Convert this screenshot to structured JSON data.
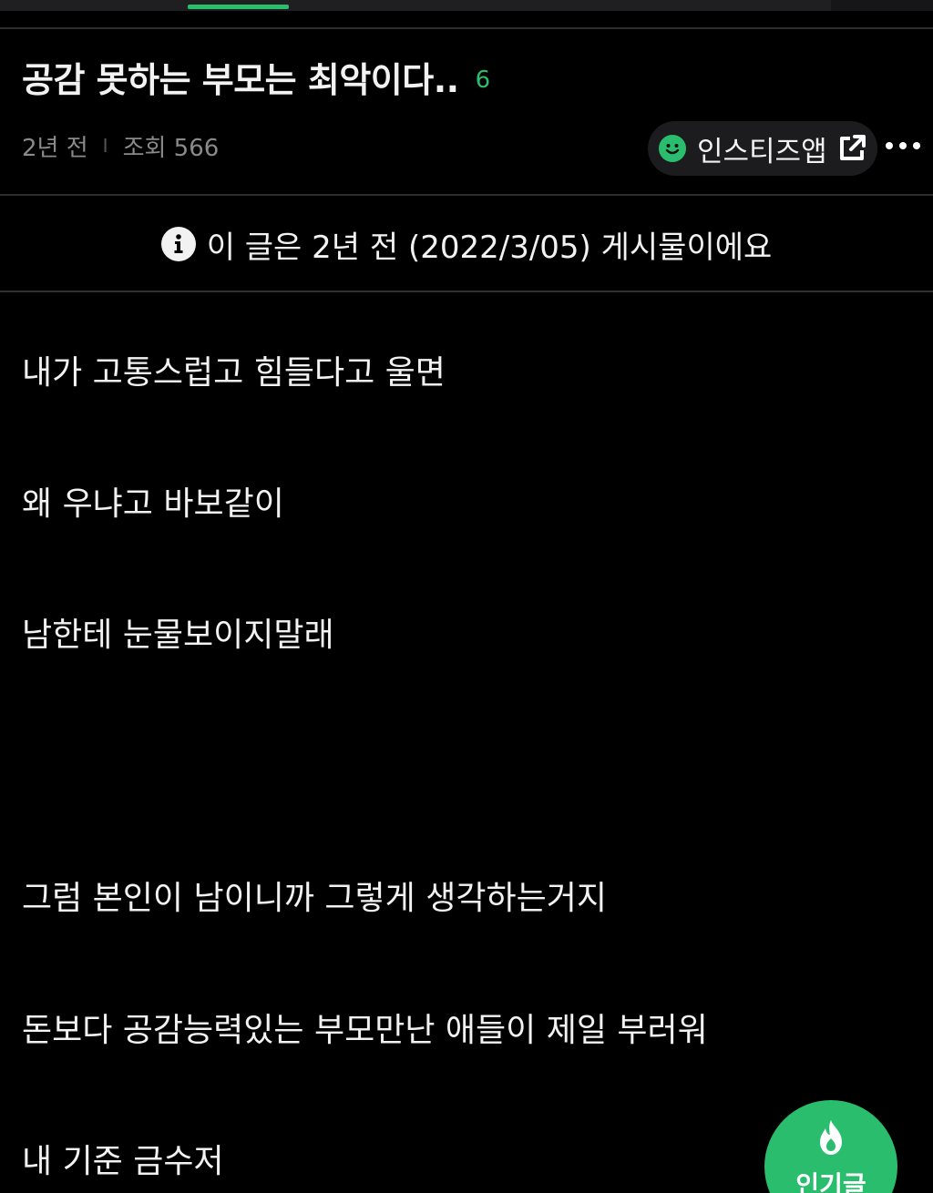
{
  "post": {
    "title": "공감 못하는 부모는 최악이다..",
    "comment_count": "6",
    "posted_ago": "2년 전",
    "views_label": "조회 566",
    "notice": "이 글은 2년 전 (2022/3/05) 게시물이에요",
    "body_lines": [
      "내가 고통스럽고 힘들다고 울면",
      "왜 우냐고 바보같이",
      "남한테 눈물보이지말래",
      "그럼 본인이 남이니까 그렇게 생각하는거지",
      "돈보다 공감능력있는 부모만난 애들이 제일 부러워",
      "내 기준 금수저"
    ]
  },
  "toolbar": {
    "app_button_label": "인스티즈앱",
    "meta_separator": "I"
  },
  "fab": {
    "label": "인기글"
  },
  "colors": {
    "accent": "#2bbd6e",
    "background": "#000000",
    "muted_text": "#8a8a8a"
  }
}
